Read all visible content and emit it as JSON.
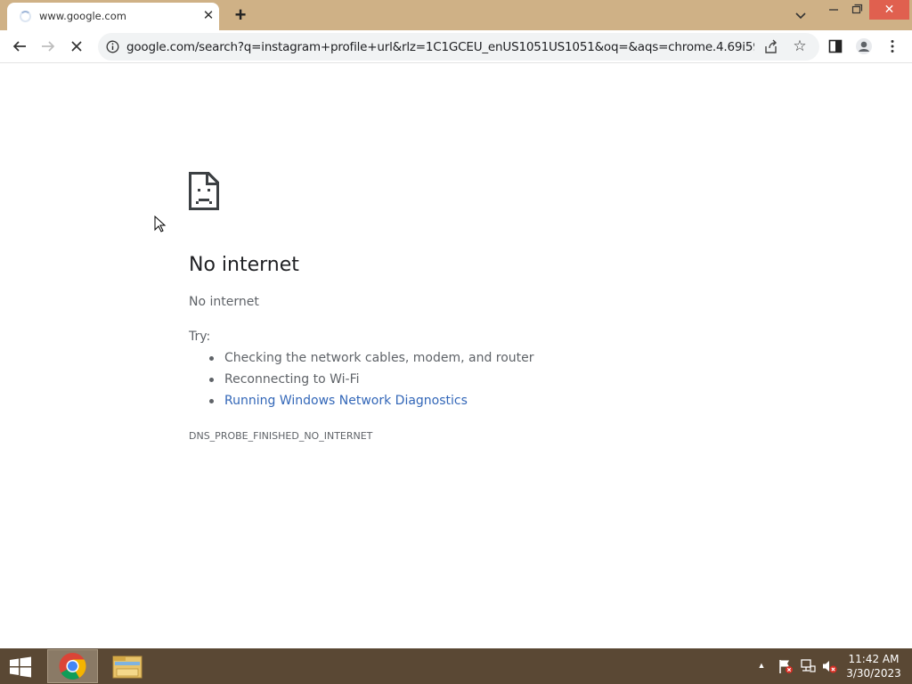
{
  "tab": {
    "title": "www.google.com",
    "close_glyph": "✕",
    "new_tab_glyph": "+"
  },
  "window_controls": {
    "close_glyph": "✕"
  },
  "address_bar": {
    "url": "google.com/search?q=instagram+profile+url&rlz=1C1GCEU_enUS1051US1051&oq=&aqs=chrome.4.69i59i450l..."
  },
  "toolbar": {
    "star_glyph": "☆"
  },
  "error_page": {
    "title": "No internet",
    "subtitle": "No internet",
    "try_label": "Try:",
    "suggestions": [
      "Checking the network cables, modem, and router",
      "Reconnecting to Wi-Fi",
      "Running Windows Network Diagnostics"
    ],
    "error_code": "DNS_PROBE_FINISHED_NO_INTERNET"
  },
  "taskbar": {
    "tray_up_glyph": "▲",
    "time": "11:42 AM",
    "date": "3/30/2023"
  },
  "colors": {
    "tabstrip": "#cfb186",
    "taskbar": "#5a4834",
    "link": "#3367b8",
    "close_button": "#e0604f"
  },
  "icons": [
    "loading-spinner-icon",
    "close-icon",
    "new-tab-icon",
    "tab-search-icon",
    "minimize-icon",
    "restore-icon",
    "back-icon",
    "forward-icon",
    "reload-stop-icon",
    "info-icon",
    "share-icon",
    "bookmark-star-icon",
    "side-panel-icon",
    "profile-icon",
    "menu-icon",
    "sad-page-icon",
    "windows-start-icon",
    "chrome-icon",
    "file-explorer-icon",
    "action-center-flag-icon",
    "network-icon",
    "volume-muted-icon"
  ]
}
